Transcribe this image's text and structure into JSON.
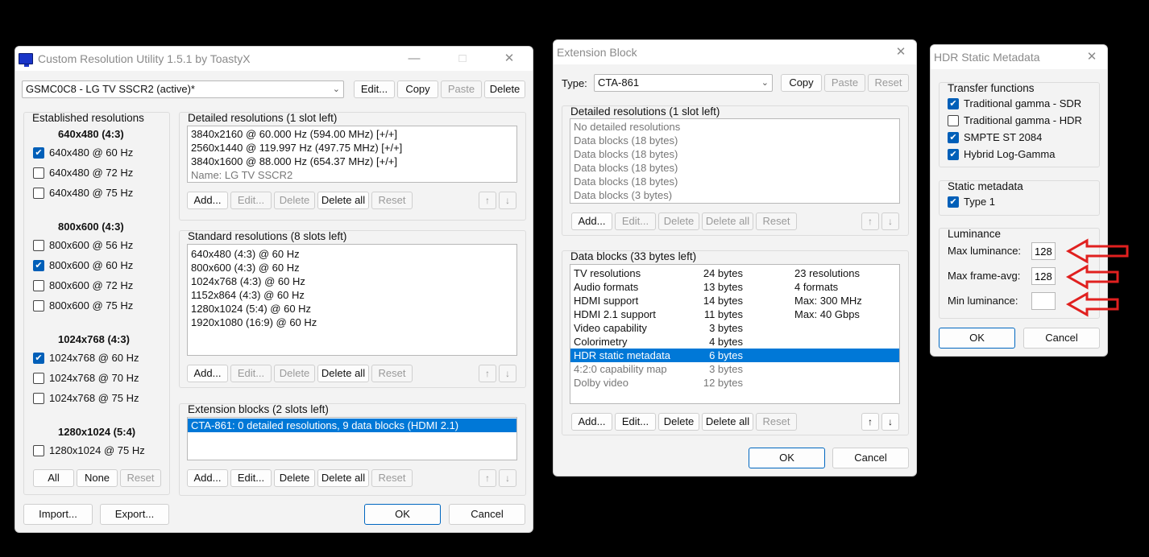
{
  "cru": {
    "title": "Custom Resolution Utility 1.5.1 by ToastyX",
    "monitor_value": "GSMC0C8 - LG TV SSCR2 (active)*",
    "top_buttons": [
      "Edit...",
      "Copy",
      "Paste",
      "Delete"
    ],
    "established": {
      "title": "Established resolutions",
      "groups": [
        {
          "heading": "640x480 (4:3)",
          "items": [
            {
              "label": "640x480 @ 60 Hz",
              "checked": true
            },
            {
              "label": "640x480 @ 72 Hz",
              "checked": false
            },
            {
              "label": "640x480 @ 75 Hz",
              "checked": false
            }
          ]
        },
        {
          "heading": "800x600 (4:3)",
          "items": [
            {
              "label": "800x600 @ 56 Hz",
              "checked": false
            },
            {
              "label": "800x600 @ 60 Hz",
              "checked": true
            },
            {
              "label": "800x600 @ 72 Hz",
              "checked": false
            },
            {
              "label": "800x600 @ 75 Hz",
              "checked": false
            }
          ]
        },
        {
          "heading": "1024x768 (4:3)",
          "items": [
            {
              "label": "1024x768 @ 60 Hz",
              "checked": true
            },
            {
              "label": "1024x768 @ 70 Hz",
              "checked": false
            },
            {
              "label": "1024x768 @ 75 Hz",
              "checked": false
            }
          ]
        },
        {
          "heading": "1280x1024 (5:4)",
          "items": [
            {
              "label": "1280x1024 @ 75 Hz",
              "checked": false
            }
          ]
        }
      ],
      "buttons": [
        "All",
        "None",
        "Reset"
      ]
    },
    "detailed": {
      "title": "Detailed resolutions (1 slot left)",
      "items": [
        "3840x2160 @ 60.000 Hz (594.00 MHz) [+/+]",
        "2560x1440 @ 119.997 Hz (497.75 MHz) [+/+]",
        "3840x1600 @ 88.000 Hz (654.37 MHz) [+/+]"
      ],
      "name_line": "Name: LG TV SSCR2"
    },
    "standard": {
      "title": "Standard resolutions (8 slots left)",
      "items": [
        "640x480 (4:3) @ 60 Hz",
        "800x600 (4:3) @ 60 Hz",
        "1024x768 (4:3) @ 60 Hz",
        "1152x864 (4:3) @ 60 Hz",
        "1280x1024 (5:4) @ 60 Hz",
        "1920x1080 (16:9) @ 60 Hz"
      ]
    },
    "extension": {
      "title": "Extension blocks (2 slots left)",
      "items": [
        "CTA-861: 0 detailed resolutions, 9 data blocks (HDMI 2.1)"
      ]
    },
    "row_buttons": [
      "Add...",
      "Edit...",
      "Delete",
      "Delete all",
      "Reset"
    ],
    "bottom": {
      "import": "Import...",
      "export": "Export...",
      "ok": "OK",
      "cancel": "Cancel"
    }
  },
  "ext": {
    "title": "Extension Block",
    "type_label": "Type:",
    "type_value": "CTA-861",
    "top_buttons": [
      "Copy",
      "Paste",
      "Reset"
    ],
    "detailed": {
      "title": "Detailed resolutions (1 slot left)",
      "items": [
        "No detailed resolutions",
        "Data blocks (18 bytes)",
        "Data blocks (18 bytes)",
        "Data blocks (18 bytes)",
        "Data blocks (18 bytes)",
        "Data blocks (3 bytes)"
      ]
    },
    "datablocks": {
      "title": "Data blocks (33 bytes left)",
      "rows": [
        {
          "name": "TV resolutions",
          "bytes": "24 bytes",
          "info": "23 resolutions"
        },
        {
          "name": "Audio formats",
          "bytes": "13 bytes",
          "info": "4 formats"
        },
        {
          "name": "HDMI support",
          "bytes": "14 bytes",
          "info": "Max: 300 MHz"
        },
        {
          "name": "HDMI 2.1 support",
          "bytes": "11 bytes",
          "info": "Max: 40 Gbps"
        },
        {
          "name": "Video capability",
          "bytes": "3 bytes",
          "info": ""
        },
        {
          "name": "Colorimetry",
          "bytes": "4 bytes",
          "info": ""
        },
        {
          "name": "HDR static metadata",
          "bytes": "6 bytes",
          "info": ""
        },
        {
          "name": "4:2:0 capability map",
          "bytes": "3 bytes",
          "info": ""
        },
        {
          "name": "Dolby video",
          "bytes": "12 bytes",
          "info": ""
        }
      ]
    },
    "row_buttons": [
      "Add...",
      "Edit...",
      "Delete",
      "Delete all",
      "Reset"
    ],
    "ok": "OK",
    "cancel": "Cancel"
  },
  "hdr": {
    "title": "HDR Static Metadata",
    "transfer": {
      "title": "Transfer functions",
      "items": [
        {
          "label": "Traditional gamma - SDR",
          "checked": true
        },
        {
          "label": "Traditional gamma - HDR",
          "checked": false
        },
        {
          "label": "SMPTE ST 2084",
          "checked": true
        },
        {
          "label": "Hybrid Log-Gamma",
          "checked": true
        }
      ]
    },
    "static": {
      "title": "Static metadata",
      "type1_label": "Type 1",
      "type1_checked": true
    },
    "luminance": {
      "title": "Luminance",
      "max_label": "Max luminance:",
      "max_value": "128",
      "avg_label": "Max frame-avg:",
      "avg_value": "128",
      "min_label": "Min luminance:",
      "min_value": ""
    },
    "ok": "OK",
    "cancel": "Cancel"
  },
  "colors": {
    "selection": "#0078d7",
    "checkbox": "#005fb8",
    "annotation_arrow": "#e0201f"
  }
}
